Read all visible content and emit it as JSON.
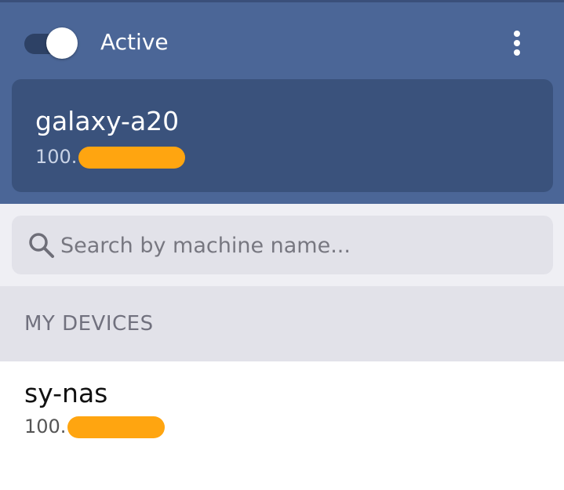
{
  "header": {
    "toggle": {
      "state": "on"
    },
    "status_label": "Active",
    "menu_icon": "more-vertical-icon",
    "self_device": {
      "name": "galaxy-a20",
      "ip_prefix": "100."
    }
  },
  "search": {
    "placeholder": "Search by machine name...",
    "value": "",
    "icon": "search-icon"
  },
  "section": {
    "title": "MY DEVICES"
  },
  "devices": [
    {
      "name": "sy-nas",
      "ip_prefix": "100."
    }
  ],
  "colors": {
    "header_bg": "#4b6697",
    "card_bg": "#3a527c",
    "redaction": "#ffa510"
  }
}
